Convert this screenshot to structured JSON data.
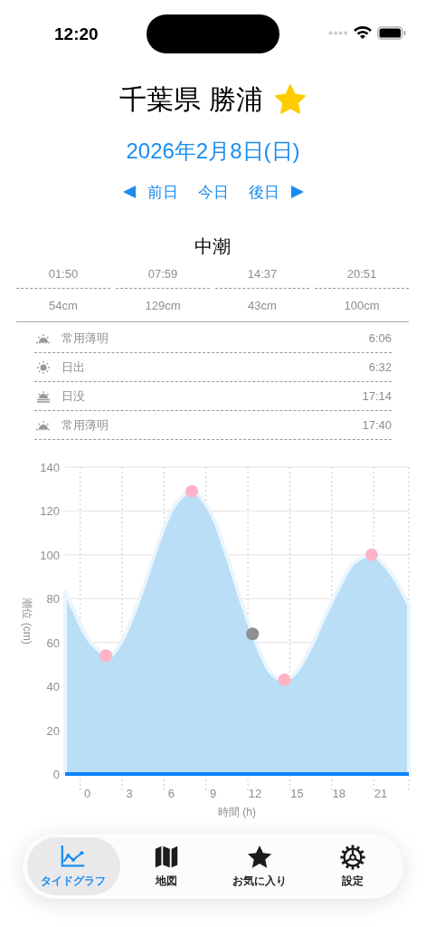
{
  "status_bar": {
    "time": "12:20"
  },
  "header": {
    "title": "千葉県 勝浦",
    "favorite": true,
    "date": "2026年2月8日(日)",
    "nav": [
      {
        "label": "前日",
        "kind": "prev"
      },
      {
        "label": "今日",
        "kind": "today"
      },
      {
        "label": "後日",
        "kind": "next"
      }
    ]
  },
  "tide": {
    "name": "中潮",
    "events": [
      {
        "time": "01:50",
        "height": "54cm"
      },
      {
        "time": "07:59",
        "height": "129cm"
      },
      {
        "time": "14:37",
        "height": "43cm"
      },
      {
        "time": "20:51",
        "height": "100cm"
      }
    ]
  },
  "sun_events": [
    {
      "kind": "twilight",
      "label": "常用薄明",
      "time": "6:06"
    },
    {
      "kind": "sunrise",
      "label": "日出",
      "time": "6:32"
    },
    {
      "kind": "sunset",
      "label": "日没",
      "time": "17:14"
    },
    {
      "kind": "twilight",
      "label": "常用薄明",
      "time": "17:40"
    }
  ],
  "chart": {
    "chart_data": {
      "type": "area",
      "xlabel": "時間 (h)",
      "ylabel": "潮位 (cm)",
      "grid": true,
      "x": [
        -1.6,
        -1,
        0,
        1.31,
        2,
        3,
        4,
        5,
        6,
        7,
        7.46,
        8,
        9,
        10,
        11,
        11.81,
        13,
        14.1,
        15,
        16,
        17,
        18,
        19,
        20.33,
        21,
        22,
        23
      ],
      "series": [
        {
          "color": "#b9def6",
          "values": [
            83,
            75,
            62,
            54,
            56,
            68,
            85,
            104,
            120,
            128,
            129,
            127,
            117,
            99,
            79,
            64,
            47,
            43,
            47,
            58,
            72,
            85,
            96,
            100,
            97,
            89,
            77
          ]
        }
      ],
      "xlim": [
        -1.6,
        23
      ],
      "ylim": [
        0,
        140
      ],
      "xticks": [
        0,
        3,
        6,
        9,
        12,
        15,
        18,
        21
      ],
      "yticks": [
        0,
        20,
        40,
        60,
        80,
        100,
        120,
        140
      ]
    }
  },
  "tabs": [
    {
      "label": "タイドグラフ",
      "selected": true
    },
    {
      "label": "地図",
      "selected": false
    },
    {
      "label": "お気に入り",
      "selected": false
    },
    {
      "label": "設定",
      "selected": false
    }
  ]
}
